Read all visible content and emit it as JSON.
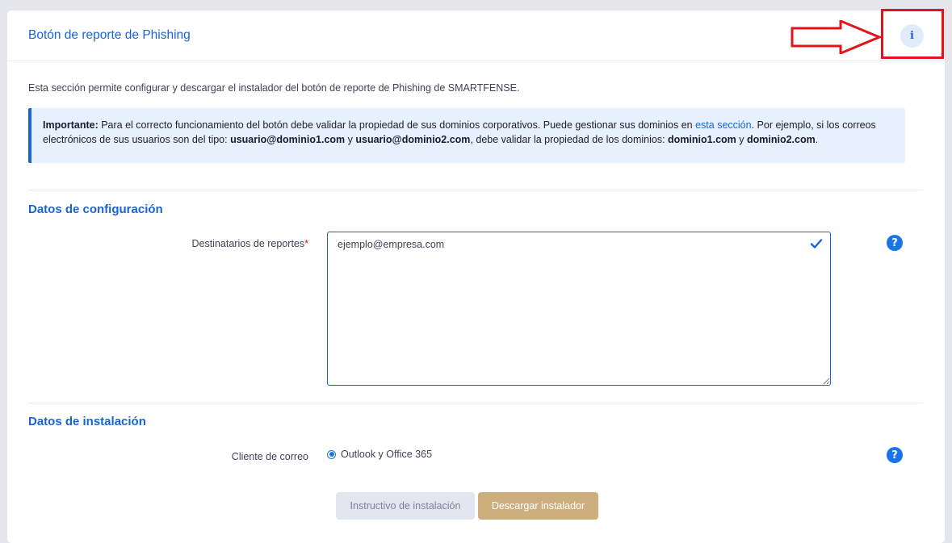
{
  "card": {
    "title": "Botón de reporte de Phishing",
    "info_icon": "i"
  },
  "intro": "Esta sección permite configurar y descargar el instalador del botón de reporte de Phishing de SMARTFENSE.",
  "alert": {
    "label": "Importante:",
    "text1": " Para el correcto funcionamiento del botón debe validar la propiedad de sus dominios corporativos. Puede gestionar sus dominios en ",
    "link": "esta sección",
    "text2": ". Por ejemplo, si los correos electrónicos de sus usuarios son del tipo: ",
    "email1": "usuario@dominio1.com",
    "text3": " y ",
    "email2": "usuario@dominio2.com",
    "text4": ", debe validar la propiedad de los dominios: ",
    "domain1": "dominio1.com",
    "text5": " y ",
    "domain2": "dominio2.com",
    "text6": "."
  },
  "config": {
    "title": "Datos de configuración",
    "recipients_label": "Destinatarios de reportes",
    "required_mark": "*",
    "recipients_value": "ejemplo@empresa.com",
    "help_icon": "?"
  },
  "install": {
    "title": "Datos de instalación",
    "client_label": "Cliente de correo",
    "client_option": "Outlook y Office 365",
    "help_icon": "?"
  },
  "buttons": {
    "instructions": "Instructivo de instalación",
    "download": "Descargar instalador"
  },
  "colors": {
    "accent": "#1a63d6",
    "highlight": "#e3131b",
    "download_button": "#cdae7d",
    "secondary_button": "#e4e6ef",
    "alert_bg": "#e6f1fd"
  }
}
